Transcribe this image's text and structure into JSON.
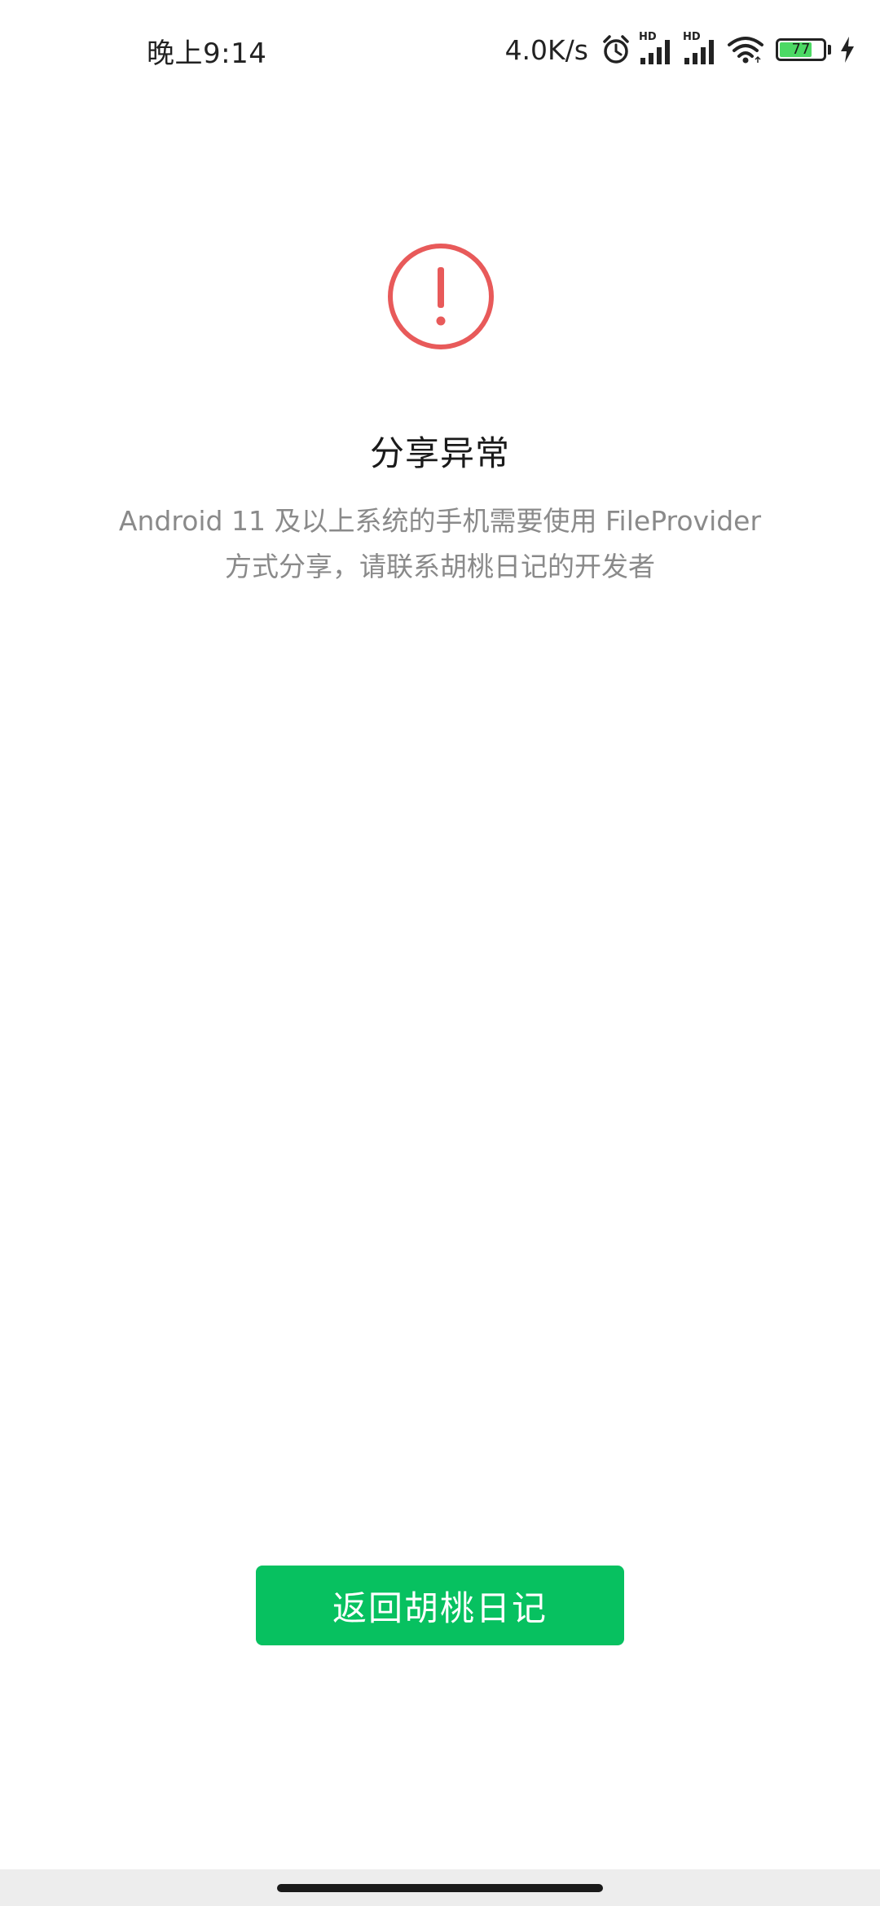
{
  "status_bar": {
    "time": "晚上9:14",
    "net_speed": "4.0K/s",
    "signal_1_label": "HD",
    "signal_2_label": "HD",
    "battery_level": "77",
    "battery_percent": 77,
    "icons": [
      "alarm-icon",
      "signal-hd-icon",
      "signal-hd-icon",
      "wifi-icon",
      "battery-icon",
      "charging-bolt-icon"
    ]
  },
  "main": {
    "icon": "exclamation-circle-icon",
    "title": "分享异常",
    "message_line_1": "Android 11 及以上系统的手机需要使用 FileProvider",
    "message_line_2": "方式分享，请联系胡桃日记的开发者"
  },
  "actions": {
    "back_label": "返回胡桃日记"
  },
  "colors": {
    "accent_green": "#07c160",
    "warning_red": "#e85a5a",
    "battery_green": "#4cd964"
  }
}
